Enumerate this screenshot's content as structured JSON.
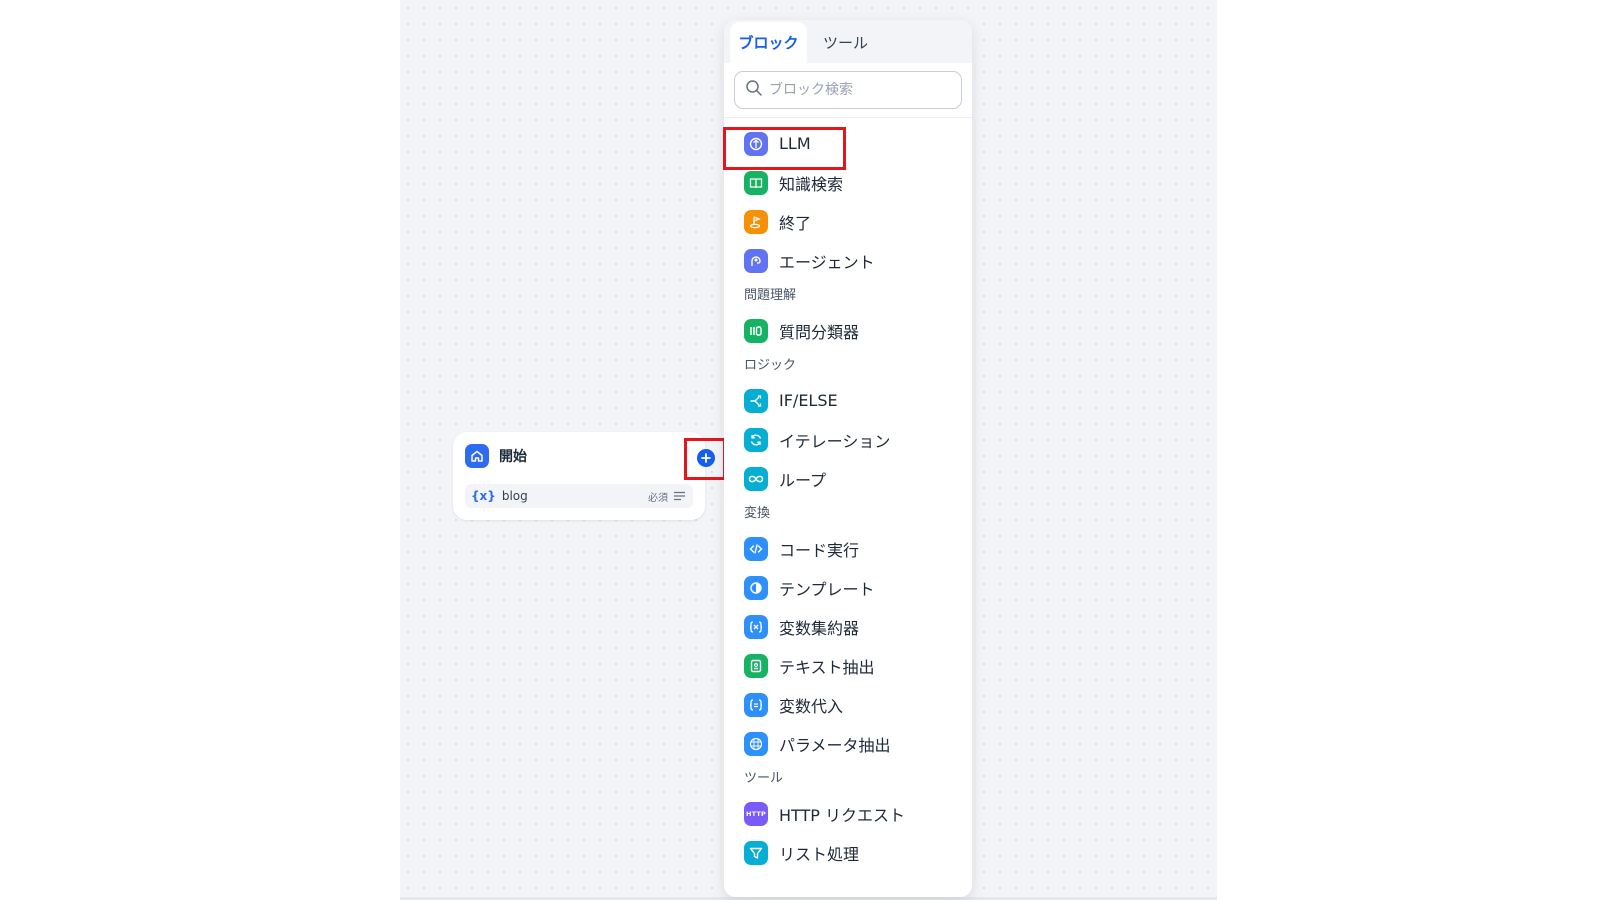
{
  "start_node": {
    "title": "開始",
    "variable": {
      "name": "blog",
      "icon": "{x}",
      "required": "必須"
    }
  },
  "panel": {
    "tabs": [
      {
        "label": "ブロック",
        "active": true
      },
      {
        "label": "ツール",
        "active": false
      }
    ],
    "search": {
      "placeholder": "ブロック検索"
    },
    "items": {
      "llm": "LLM",
      "knowledge": "知識検索",
      "end": "終了",
      "agent": "エージェント",
      "question_classifier": "質問分類器",
      "if_else": "IF/ELSE",
      "iteration": "イテレーション",
      "loop": "ループ",
      "code": "コード実行",
      "template": "テンプレート",
      "var_aggregator": "変数集約器",
      "text_extract": "テキスト抽出",
      "var_assign": "変数代入",
      "param_extract": "パラメータ抽出",
      "http": "HTTP リクエスト",
      "list": "リスト処理"
    },
    "groups": {
      "question": "問題理解",
      "logic": "ロジック",
      "transform": "変換",
      "tools": "ツール"
    }
  },
  "icon_labels": {
    "http": "HTTP"
  },
  "colors": {
    "accent": "#155eef",
    "highlight": "#e5161b",
    "indigo": "#6172f3",
    "green": "#16b364",
    "orange": "#f79009",
    "cyan": "#06aed4",
    "blue": "#2e90fa",
    "purple": "#7a5af8"
  }
}
